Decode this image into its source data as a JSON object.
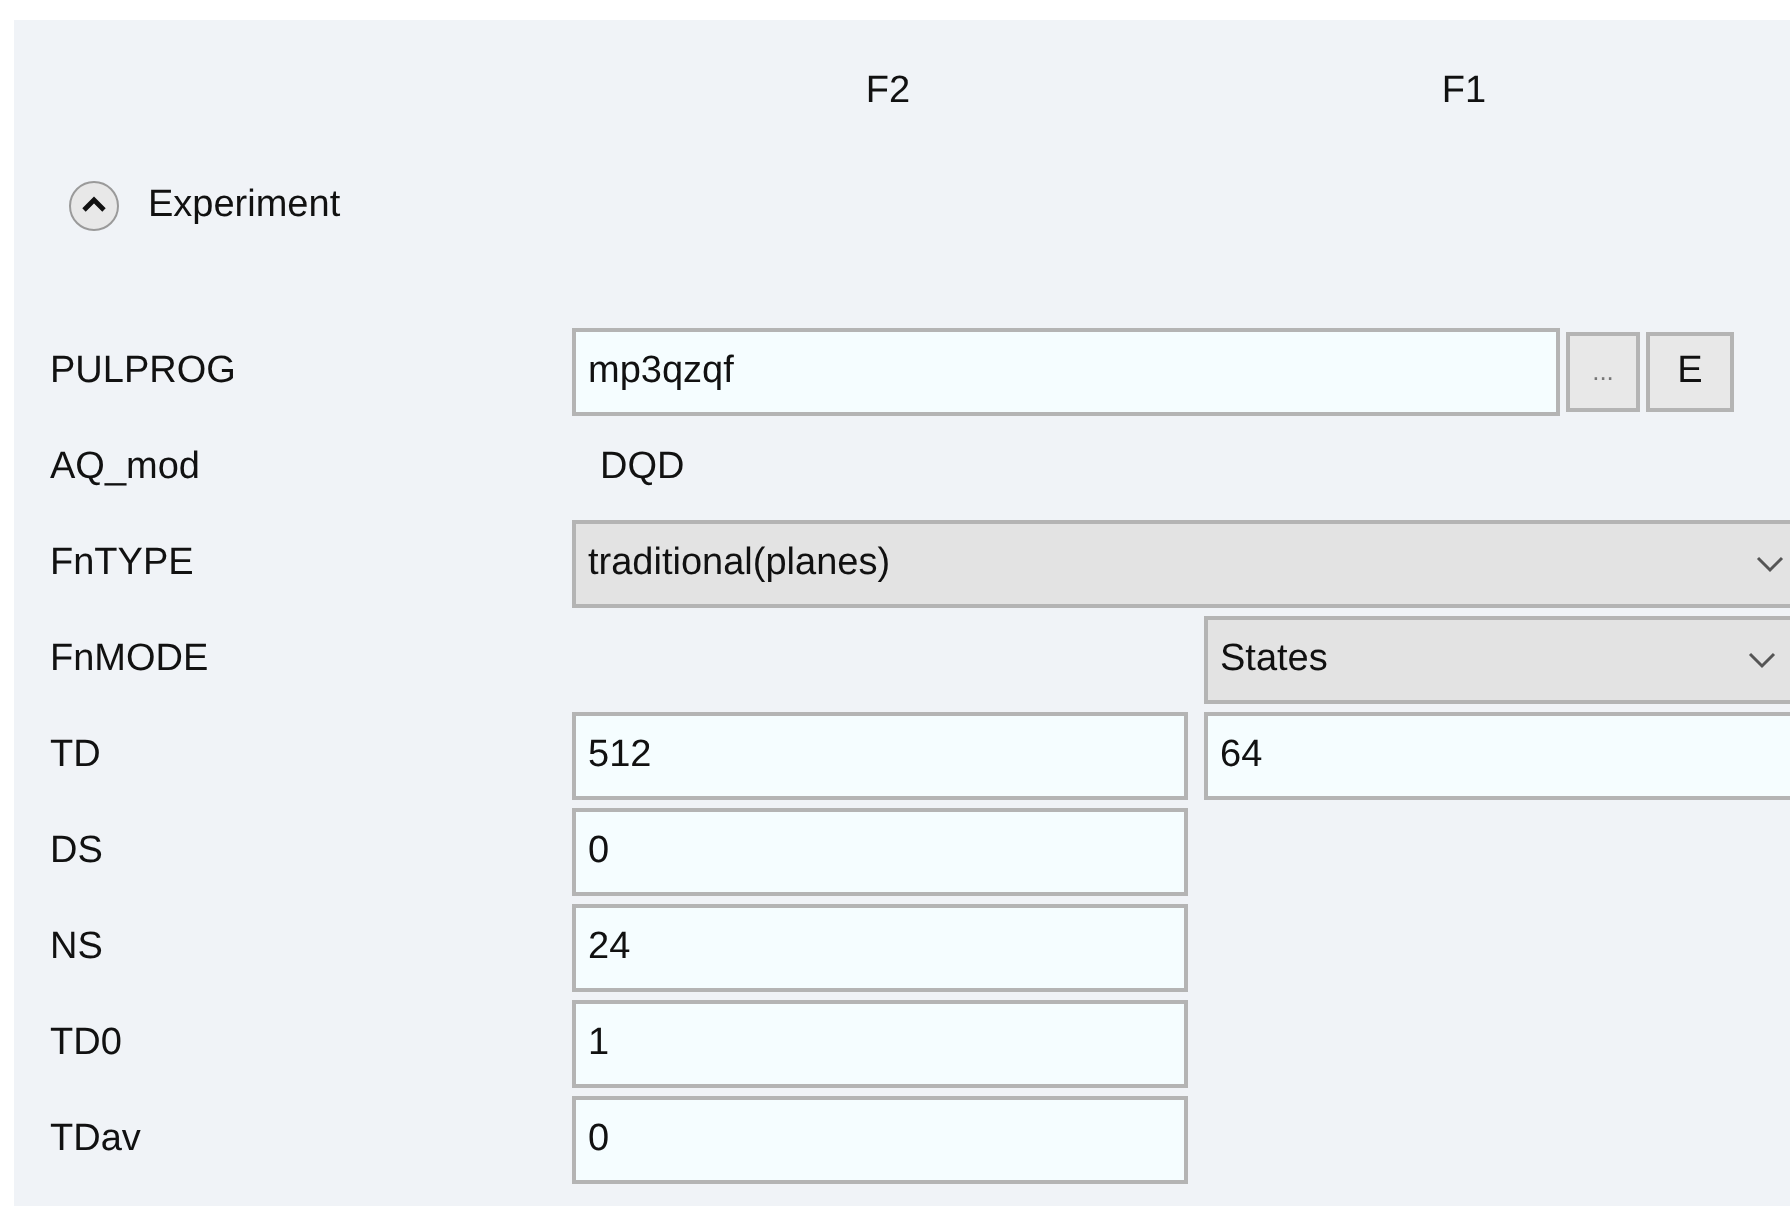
{
  "columns": [
    "F2",
    "F1"
  ],
  "section": {
    "title": "Experiment",
    "expanded": true
  },
  "rows": [
    {
      "kind": "field_buttons",
      "label": "PULPROG",
      "value": "mp3qzqf",
      "buttons": [
        "...",
        "E"
      ]
    },
    {
      "kind": "static",
      "label": "AQ_mod",
      "value": "DQD"
    },
    {
      "kind": "select_wide",
      "label": "FnTYPE",
      "value": "traditional(planes)"
    },
    {
      "kind": "select_f1",
      "label": "FnMODE",
      "value": "States"
    },
    {
      "kind": "fields",
      "label": "TD",
      "values": [
        "512",
        "64"
      ]
    },
    {
      "kind": "fields",
      "label": "DS",
      "values": [
        "0"
      ]
    },
    {
      "kind": "fields",
      "label": "NS",
      "values": [
        "24"
      ]
    },
    {
      "kind": "fields",
      "label": "TD0",
      "values": [
        "1"
      ]
    },
    {
      "kind": "fields",
      "label": "TDav",
      "values": [
        "0"
      ]
    }
  ]
}
